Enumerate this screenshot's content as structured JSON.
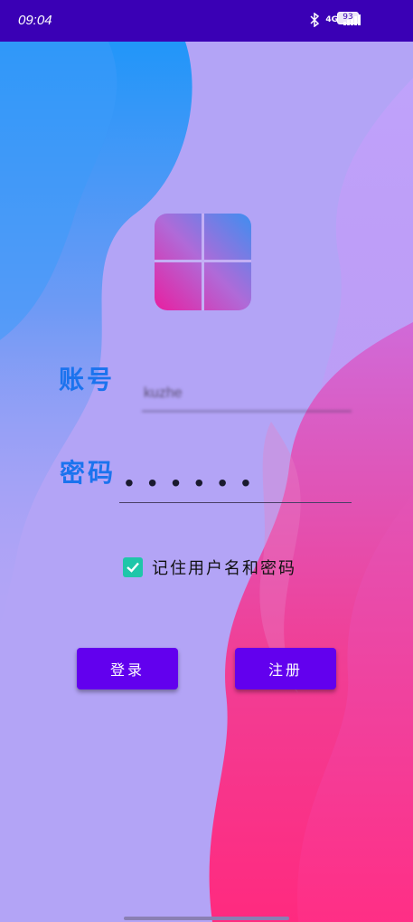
{
  "status_bar": {
    "time": "09:04",
    "network": "4G",
    "battery": "93",
    "icons": [
      "bluetooth-icon",
      "signal-icon",
      "battery-icon"
    ]
  },
  "logo": {
    "icon": "windows-logo-icon"
  },
  "login_form": {
    "username_label": "账号",
    "username_value": "kuzhe",
    "password_label": "密码",
    "password_value": "••••••",
    "remember_label": "记住用户名和密码",
    "remember_checked": true
  },
  "buttons": {
    "login": "登录",
    "register": "注册"
  },
  "colors": {
    "status_bar": "#3a00b5",
    "button": "#6200ee",
    "label": "#1b73ee",
    "checkbox": "#1fc6a9",
    "background": "#b3a4f6"
  }
}
